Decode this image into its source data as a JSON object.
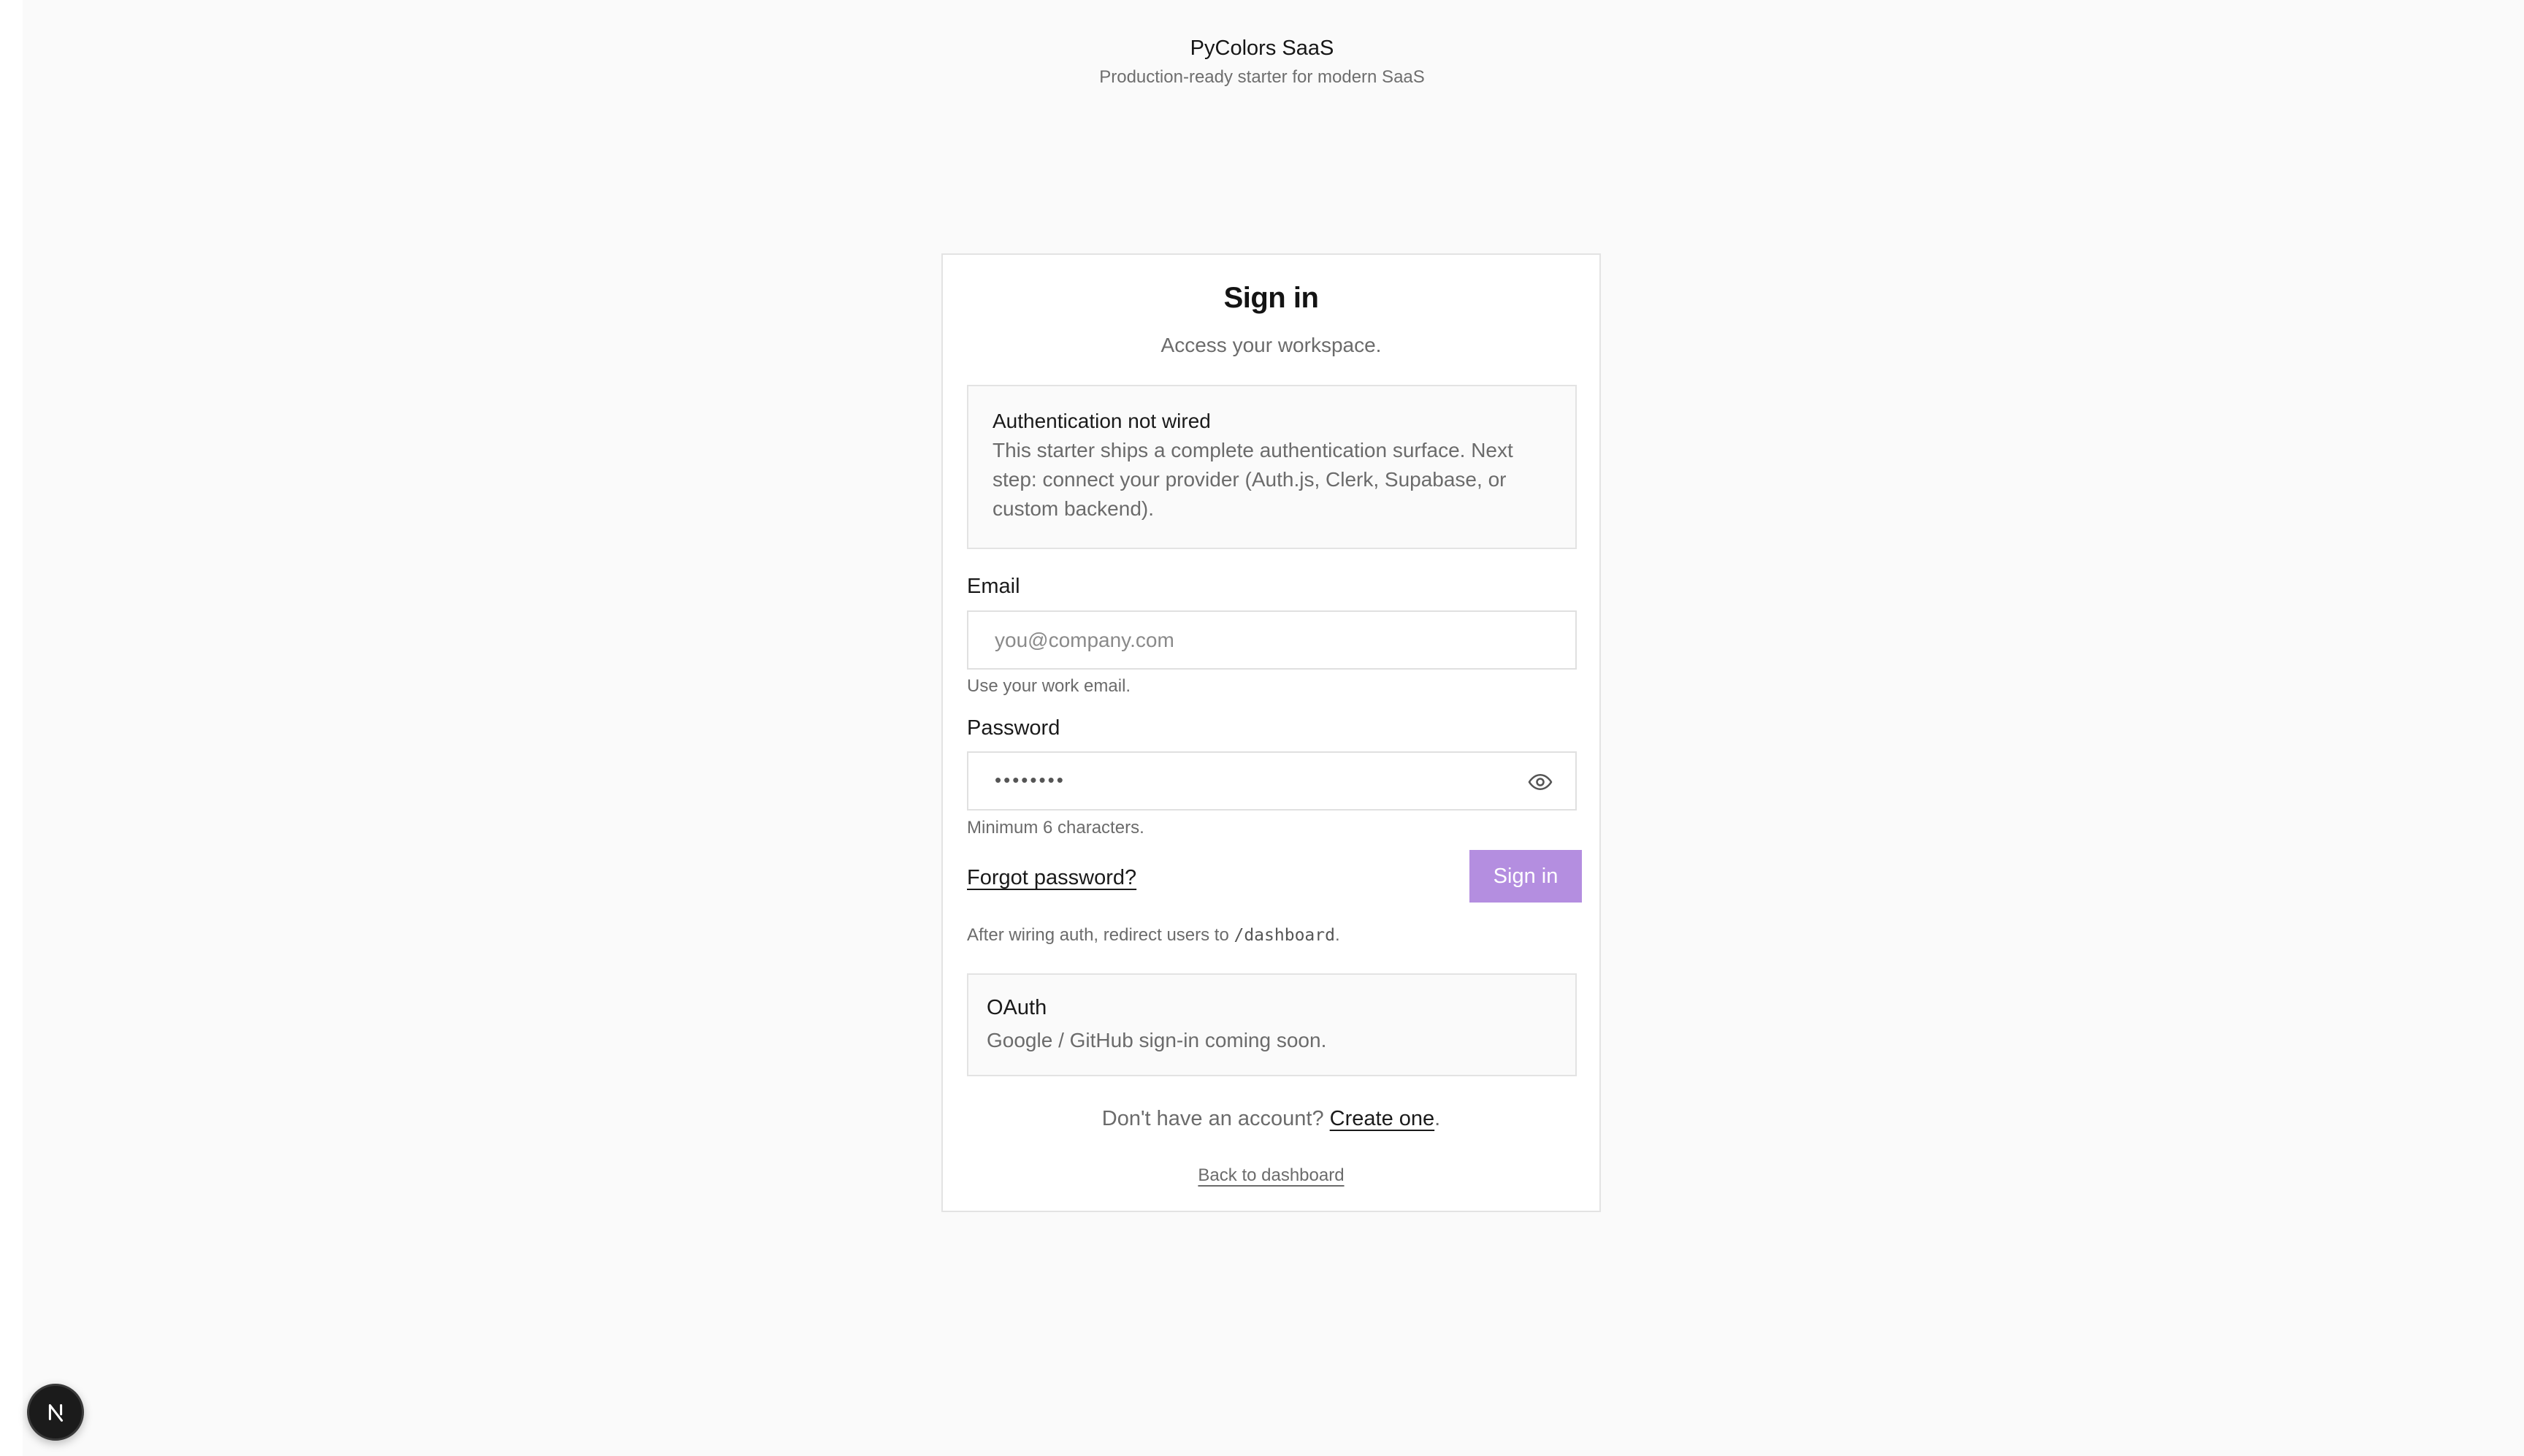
{
  "header": {
    "title": "PyColors SaaS",
    "subtitle": "Production-ready starter for modern SaaS"
  },
  "card": {
    "title": "Sign in",
    "description": "Access your workspace."
  },
  "notice": {
    "title": "Authentication not wired",
    "body": "This starter ships a complete authentication surface. Next step: connect your provider (Auth.js, Clerk, Supabase, or custom backend)."
  },
  "form": {
    "email_label": "Email",
    "email_placeholder": "you@company.com",
    "email_value": "",
    "email_hint": "Use your work email.",
    "password_label": "Password",
    "password_masked": "••••••••",
    "password_hint": "Minimum 6 characters.",
    "forgot_label": "Forgot password?",
    "submit_label": "Sign in",
    "submit_color": "#b48ee0",
    "after_note_prefix": "After wiring auth, redirect users to ",
    "after_note_path": "/dashboard",
    "after_note_suffix": "."
  },
  "oauth": {
    "title": "OAuth",
    "body": "Google / GitHub sign-in coming soon."
  },
  "footer": {
    "signup_prefix": "Don't have an account? ",
    "signup_link": "Create one",
    "signup_suffix": ".",
    "back_link": "Back to dashboard"
  },
  "icons": {
    "password_toggle": "eye-icon",
    "dev_badge": "nextjs-logo-icon"
  }
}
